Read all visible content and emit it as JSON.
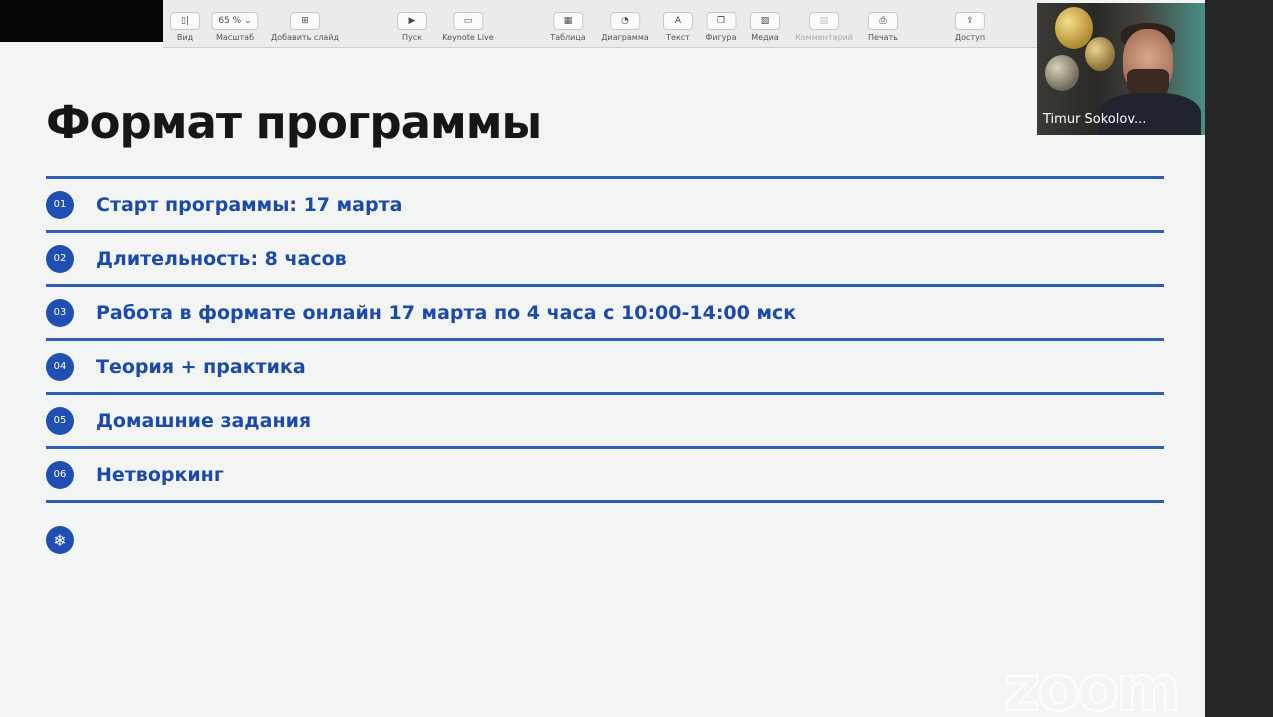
{
  "toolbar": {
    "items": [
      {
        "label": "Вид",
        "button": "▯|"
      },
      {
        "label": "Масштаб",
        "button": "65 % ⌄"
      },
      {
        "label": "Добавить слайд",
        "button": "⊞"
      },
      {
        "label": "Пуск",
        "button": "▶"
      },
      {
        "label": "Keynote Live",
        "button": "▭"
      },
      {
        "label": "Таблица",
        "button": "▦"
      },
      {
        "label": "Диаграмма",
        "button": "◔"
      },
      {
        "label": "Текст",
        "button": "A"
      },
      {
        "label": "Фигура",
        "button": "❐"
      },
      {
        "label": "Медиа",
        "button": "▨"
      },
      {
        "label": "Комментарий",
        "button": "▤"
      },
      {
        "label": "Печать",
        "button": "⎙"
      },
      {
        "label": "Доступ",
        "button": "⇪"
      }
    ]
  },
  "video": {
    "participant_name": "Timur Sokolov..."
  },
  "slide": {
    "title": "Формат программы",
    "items": [
      {
        "num": "01",
        "text": "Старт программы: 17 марта"
      },
      {
        "num": "02",
        "text": "Длительность: 8 часов"
      },
      {
        "num": "03",
        "text": "Работа в формате онлайн 17 марта по 4 часа с 10:00-14:00 мск"
      },
      {
        "num": "04",
        "text": "Теория + практика"
      },
      {
        "num": "05",
        "text": "Домашние задания"
      },
      {
        "num": "06",
        "text": "Нетворкинг"
      }
    ],
    "extra_icon": "❄"
  },
  "watermark": {
    "text": "zoom"
  },
  "colors": {
    "accent": "#1f4fb0",
    "rule": "#2f5eb4",
    "title": "#161616"
  }
}
